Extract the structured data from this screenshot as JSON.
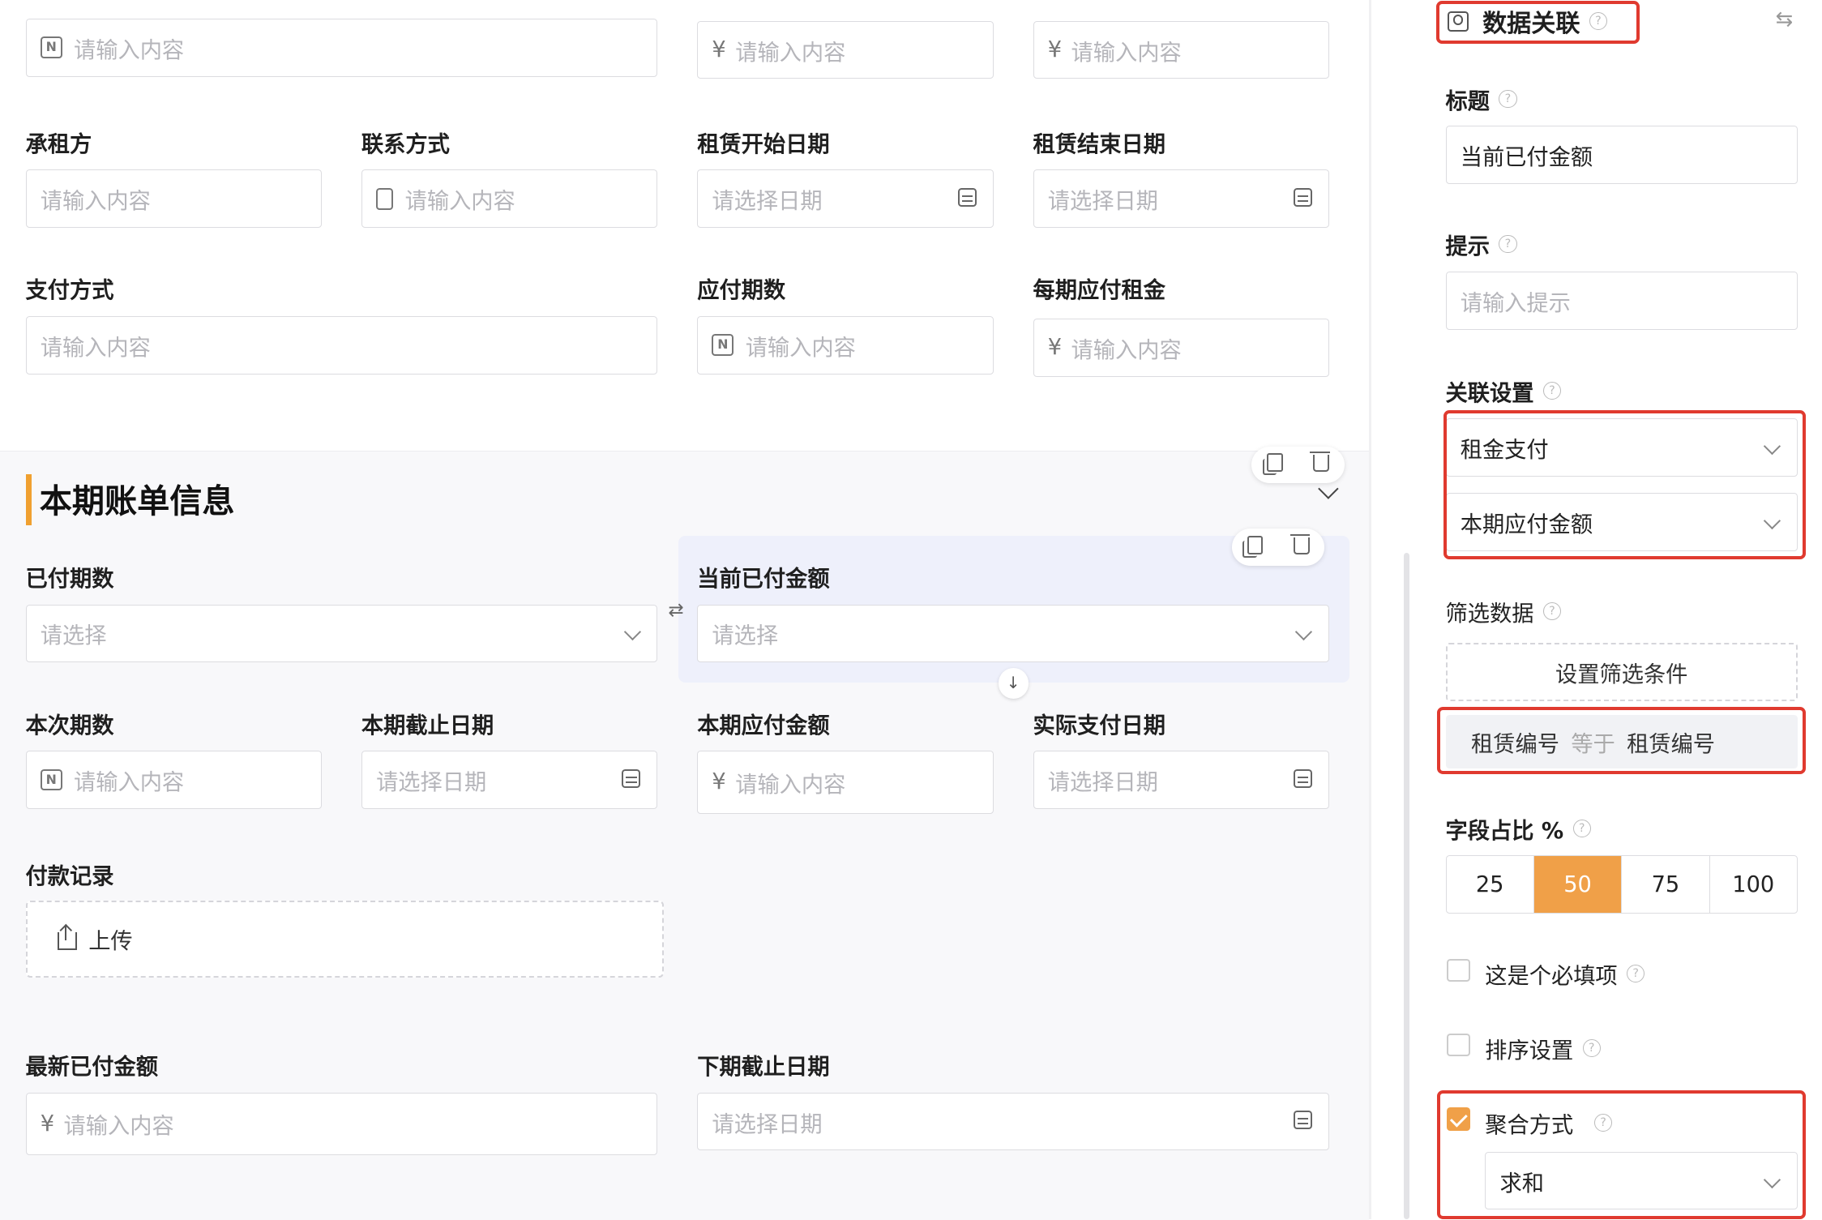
{
  "form": {
    "top_row": [
      {
        "placeholder": "请输入内容",
        "prefix": "N"
      },
      {
        "placeholder": "请输入内容",
        "prefix": "¥"
      },
      {
        "placeholder": "请输入内容",
        "prefix": "¥"
      }
    ],
    "row1": [
      {
        "label": "承租方",
        "placeholder": "请输入内容"
      },
      {
        "label": "联系方式",
        "placeholder": "请输入内容"
      },
      {
        "label": "租赁开始日期",
        "placeholder": "请选择日期"
      },
      {
        "label": "租赁结束日期",
        "placeholder": "请选择日期"
      }
    ],
    "row2": [
      {
        "label": "支付方式",
        "placeholder": "请输入内容"
      },
      {
        "label": "应付期数",
        "placeholder": "请输入内容",
        "prefix": "N"
      },
      {
        "label": "每期应付租金",
        "placeholder": "请输入内容",
        "prefix": "¥"
      }
    ],
    "section_title": "本期账单信息",
    "row3": [
      {
        "label": "已付期数",
        "placeholder": "请选择"
      },
      {
        "label": "当前已付金额",
        "placeholder": "请选择"
      }
    ],
    "row4": [
      {
        "label": "本次期数",
        "placeholder": "请输入内容",
        "prefix": "N"
      },
      {
        "label": "本期截止日期",
        "placeholder": "请选择日期"
      },
      {
        "label": "本期应付金额",
        "placeholder": "请输入内容",
        "prefix": "¥"
      },
      {
        "label": "实际支付日期",
        "placeholder": "请选择日期"
      }
    ],
    "payment_record": {
      "label": "付款记录",
      "upload": "上传"
    },
    "row5": [
      {
        "label": "最新已付金额",
        "placeholder": "请输入内容",
        "prefix": "¥"
      },
      {
        "label": "下期截止日期",
        "placeholder": "请选择日期"
      }
    ]
  },
  "panel": {
    "header": "数据关联",
    "title_label": "标题",
    "title_value": "当前已付金额",
    "hint_label": "提示",
    "hint_placeholder": "请输入提示",
    "link_label": "关联设置",
    "link_table": "租金支付",
    "link_field": "本期应付金额",
    "filter_label": "筛选数据",
    "filter_button": "设置筛选条件",
    "filter_cond": {
      "left": "租赁编号",
      "op": "等于",
      "right": "租赁编号"
    },
    "ratio_label": "字段占比 %",
    "ratio_options": [
      "25",
      "50",
      "75",
      "100"
    ],
    "ratio_selected": "50",
    "required_label": "这是个必填项",
    "sort_label": "排序设置",
    "agg_label": "聚合方式",
    "agg_checked": true,
    "agg_value": "求和"
  },
  "colors": {
    "accent": "#f0a048",
    "highlight_box": "#e03a2f",
    "section_bar": "#f0a030"
  }
}
